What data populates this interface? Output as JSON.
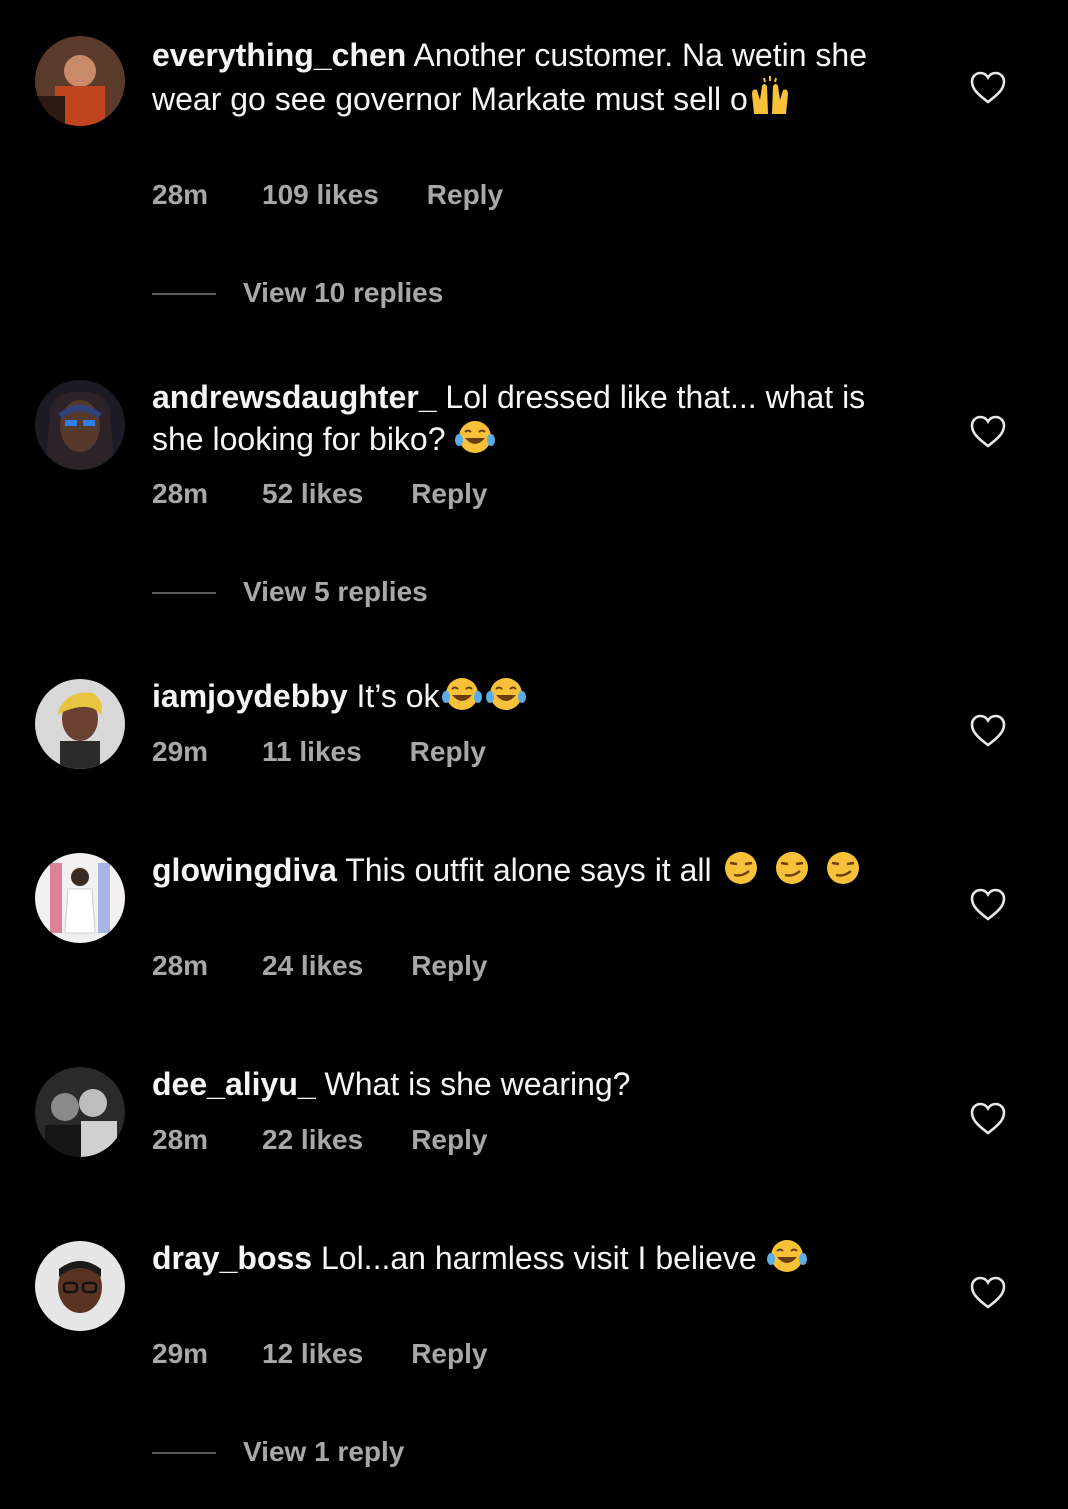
{
  "comments": [
    {
      "username": "everything_chen",
      "text_parts": [
        "Another customer. Na wetin she wear go see governor Markate must sell o"
      ],
      "emojis": [
        "raised-hands"
      ],
      "time": "28m",
      "likes": "109 likes",
      "reply": "Reply",
      "view_replies": "View 10 replies"
    },
    {
      "username": "andrewsdaughter_",
      "text_parts": [
        "Lol dressed like that... what is she looking for biko?"
      ],
      "emojis": [
        "tears-of-joy"
      ],
      "time": "28m",
      "likes": "52 likes",
      "reply": "Reply",
      "view_replies": "View 5 replies"
    },
    {
      "username": "iamjoydebby",
      "text_parts": [
        "It’s ok"
      ],
      "emojis": [
        "tears-of-joy",
        "tears-of-joy"
      ],
      "time": "29m",
      "likes": "11 likes",
      "reply": "Reply"
    },
    {
      "username": "glowingdiva",
      "text_parts": [
        "This outfit alone says it all"
      ],
      "emojis": [
        "smirk",
        "smirk",
        "smirk"
      ],
      "time": "28m",
      "likes": "24 likes",
      "reply": "Reply"
    },
    {
      "username": "dee_aliyu_",
      "text_parts": [
        "What is she wearing?"
      ],
      "emojis": [],
      "time": "28m",
      "likes": "22 likes",
      "reply": "Reply"
    },
    {
      "username": "dray_boss",
      "text_parts": [
        "Lol...an harmless visit I believe"
      ],
      "emojis": [
        "tears-of-joy"
      ],
      "time": "29m",
      "likes": "12 likes",
      "reply": "Reply",
      "view_replies": "View 1 reply"
    }
  ],
  "colors": {
    "background": "#000000",
    "text": "#f5f5f5",
    "meta": "#a8a8a8"
  }
}
